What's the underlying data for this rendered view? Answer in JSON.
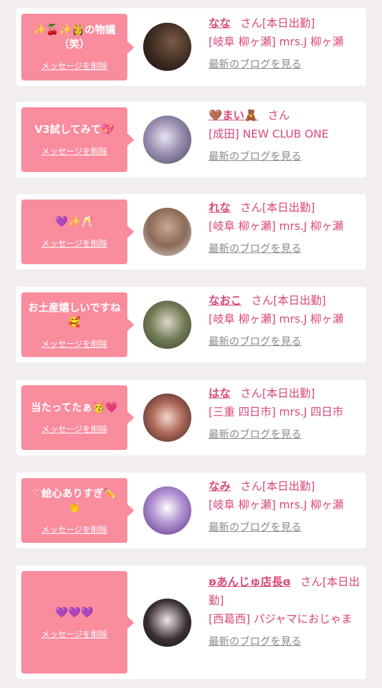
{
  "delete_label": "メッセージを削除",
  "blog_label": "最新のブログを見る",
  "honorific": "さん",
  "colors": {
    "bubble": "#f98c9d",
    "accent": "#d9477a",
    "link_gray": "#8a8a8a"
  },
  "cards": [
    {
      "message": "✨🍒✨👸の物議（笑）",
      "name": "なな",
      "status": "[本日出勤]",
      "shop": "[岐阜 柳ヶ瀬] mrs.J 柳ヶ瀬",
      "avatar_icon": "avatar-photo"
    },
    {
      "message": "V3試してみて💖",
      "name": "🤎まい🧸",
      "status": "",
      "shop": "[成田] NEW CLUB ONE",
      "avatar_icon": "avatar-photo"
    },
    {
      "message": "💜✨🥂",
      "name": "れな",
      "status": "[本日出勤]",
      "shop": "[岐阜 柳ヶ瀬] mrs.J 柳ヶ瀬",
      "avatar_icon": "avatar-photo"
    },
    {
      "message": "お土産嬉しいですね🥰",
      "name": "なおこ",
      "status": "[本日出勤]",
      "shop": "[岐阜 柳ヶ瀬] mrs.J 柳ヶ瀬",
      "avatar_icon": "avatar-photo"
    },
    {
      "message": "当たってたぁ🥳💗",
      "name": "はな",
      "status": "[本日出勤]",
      "shop": "[三重 四日市] mrs.J 四日市",
      "avatar_icon": "avatar-photo"
    },
    {
      "message": "♡絵心ありすぎ✏️👏",
      "name": "なみ",
      "status": "[本日出勤]",
      "shop": "[岐阜 柳ヶ瀬] mrs.J 柳ヶ瀬",
      "avatar_icon": "shop-logo"
    },
    {
      "message": "💜💜💜",
      "name": "ʚあんじゅ店長ɞ",
      "status": "[本日出勤]",
      "shop": "[西葛西] パジャマにおじゃま",
      "avatar_icon": "avatar-photo"
    }
  ]
}
